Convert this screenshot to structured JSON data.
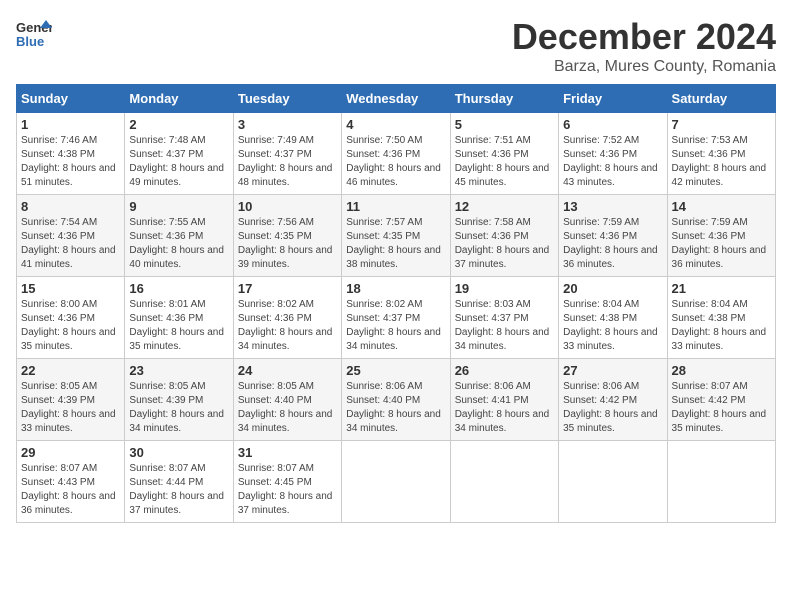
{
  "logo": {
    "text_general": "General",
    "text_blue": "Blue"
  },
  "title": "December 2024",
  "subtitle": "Barza, Mures County, Romania",
  "days_header": [
    "Sunday",
    "Monday",
    "Tuesday",
    "Wednesday",
    "Thursday",
    "Friday",
    "Saturday"
  ],
  "weeks": [
    [
      {
        "day": "1",
        "info": "Sunrise: 7:46 AM\nSunset: 4:38 PM\nDaylight: 8 hours\nand 51 minutes."
      },
      {
        "day": "2",
        "info": "Sunrise: 7:48 AM\nSunset: 4:37 PM\nDaylight: 8 hours\nand 49 minutes."
      },
      {
        "day": "3",
        "info": "Sunrise: 7:49 AM\nSunset: 4:37 PM\nDaylight: 8 hours\nand 48 minutes."
      },
      {
        "day": "4",
        "info": "Sunrise: 7:50 AM\nSunset: 4:36 PM\nDaylight: 8 hours\nand 46 minutes."
      },
      {
        "day": "5",
        "info": "Sunrise: 7:51 AM\nSunset: 4:36 PM\nDaylight: 8 hours\nand 45 minutes."
      },
      {
        "day": "6",
        "info": "Sunrise: 7:52 AM\nSunset: 4:36 PM\nDaylight: 8 hours\nand 43 minutes."
      },
      {
        "day": "7",
        "info": "Sunrise: 7:53 AM\nSunset: 4:36 PM\nDaylight: 8 hours\nand 42 minutes."
      }
    ],
    [
      {
        "day": "8",
        "info": "Sunrise: 7:54 AM\nSunset: 4:36 PM\nDaylight: 8 hours\nand 41 minutes."
      },
      {
        "day": "9",
        "info": "Sunrise: 7:55 AM\nSunset: 4:36 PM\nDaylight: 8 hours\nand 40 minutes."
      },
      {
        "day": "10",
        "info": "Sunrise: 7:56 AM\nSunset: 4:35 PM\nDaylight: 8 hours\nand 39 minutes."
      },
      {
        "day": "11",
        "info": "Sunrise: 7:57 AM\nSunset: 4:35 PM\nDaylight: 8 hours\nand 38 minutes."
      },
      {
        "day": "12",
        "info": "Sunrise: 7:58 AM\nSunset: 4:36 PM\nDaylight: 8 hours\nand 37 minutes."
      },
      {
        "day": "13",
        "info": "Sunrise: 7:59 AM\nSunset: 4:36 PM\nDaylight: 8 hours\nand 36 minutes."
      },
      {
        "day": "14",
        "info": "Sunrise: 7:59 AM\nSunset: 4:36 PM\nDaylight: 8 hours\nand 36 minutes."
      }
    ],
    [
      {
        "day": "15",
        "info": "Sunrise: 8:00 AM\nSunset: 4:36 PM\nDaylight: 8 hours\nand 35 minutes."
      },
      {
        "day": "16",
        "info": "Sunrise: 8:01 AM\nSunset: 4:36 PM\nDaylight: 8 hours\nand 35 minutes."
      },
      {
        "day": "17",
        "info": "Sunrise: 8:02 AM\nSunset: 4:36 PM\nDaylight: 8 hours\nand 34 minutes."
      },
      {
        "day": "18",
        "info": "Sunrise: 8:02 AM\nSunset: 4:37 PM\nDaylight: 8 hours\nand 34 minutes."
      },
      {
        "day": "19",
        "info": "Sunrise: 8:03 AM\nSunset: 4:37 PM\nDaylight: 8 hours\nand 34 minutes."
      },
      {
        "day": "20",
        "info": "Sunrise: 8:04 AM\nSunset: 4:38 PM\nDaylight: 8 hours\nand 33 minutes."
      },
      {
        "day": "21",
        "info": "Sunrise: 8:04 AM\nSunset: 4:38 PM\nDaylight: 8 hours\nand 33 minutes."
      }
    ],
    [
      {
        "day": "22",
        "info": "Sunrise: 8:05 AM\nSunset: 4:39 PM\nDaylight: 8 hours\nand 33 minutes."
      },
      {
        "day": "23",
        "info": "Sunrise: 8:05 AM\nSunset: 4:39 PM\nDaylight: 8 hours\nand 34 minutes."
      },
      {
        "day": "24",
        "info": "Sunrise: 8:05 AM\nSunset: 4:40 PM\nDaylight: 8 hours\nand 34 minutes."
      },
      {
        "day": "25",
        "info": "Sunrise: 8:06 AM\nSunset: 4:40 PM\nDaylight: 8 hours\nand 34 minutes."
      },
      {
        "day": "26",
        "info": "Sunrise: 8:06 AM\nSunset: 4:41 PM\nDaylight: 8 hours\nand 34 minutes."
      },
      {
        "day": "27",
        "info": "Sunrise: 8:06 AM\nSunset: 4:42 PM\nDaylight: 8 hours\nand 35 minutes."
      },
      {
        "day": "28",
        "info": "Sunrise: 8:07 AM\nSunset: 4:42 PM\nDaylight: 8 hours\nand 35 minutes."
      }
    ],
    [
      {
        "day": "29",
        "info": "Sunrise: 8:07 AM\nSunset: 4:43 PM\nDaylight: 8 hours\nand 36 minutes."
      },
      {
        "day": "30",
        "info": "Sunrise: 8:07 AM\nSunset: 4:44 PM\nDaylight: 8 hours\nand 37 minutes."
      },
      {
        "day": "31",
        "info": "Sunrise: 8:07 AM\nSunset: 4:45 PM\nDaylight: 8 hours\nand 37 minutes."
      },
      {
        "day": "",
        "info": ""
      },
      {
        "day": "",
        "info": ""
      },
      {
        "day": "",
        "info": ""
      },
      {
        "day": "",
        "info": ""
      }
    ]
  ]
}
